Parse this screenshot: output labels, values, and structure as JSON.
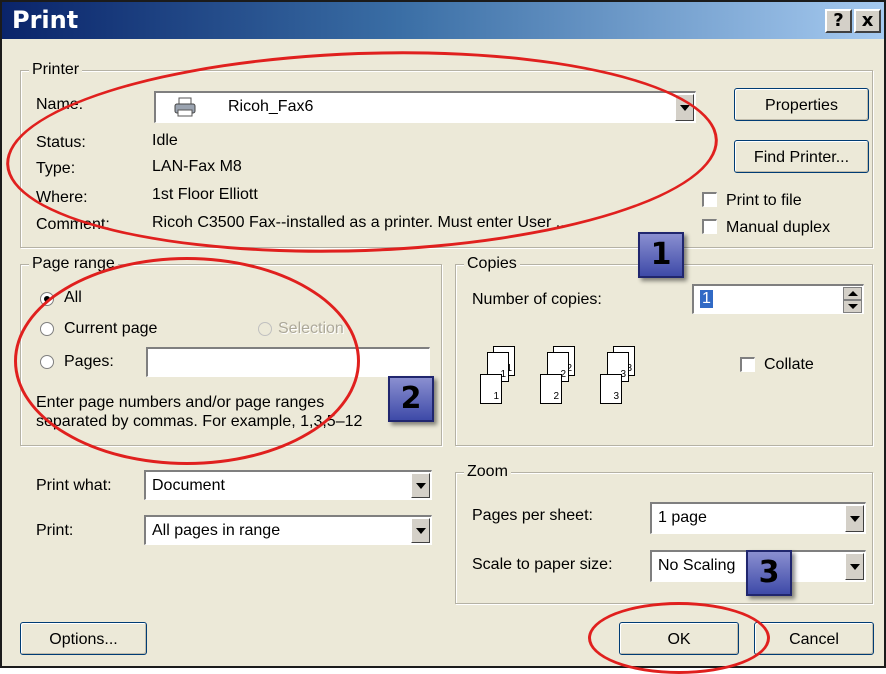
{
  "window": {
    "title": "Print",
    "help_btn": "?",
    "close_btn": "x"
  },
  "printer": {
    "group_label": "Printer",
    "name_label": "Name:",
    "name_value": "Ricoh_Fax6",
    "status_label": "Status:",
    "status_value": "Idle",
    "type_label": "Type:",
    "type_value": "LAN-Fax M8",
    "where_label": "Where:",
    "where_value": "1st Floor Elliott",
    "comment_label": "Comment:",
    "comment_value": "Ricoh C3500 Fax--installed as a printer. Must enter User ...",
    "properties_btn": "Properties",
    "find_printer_btn": "Find Printer...",
    "print_to_file": "Print to file",
    "manual_duplex": "Manual duplex"
  },
  "page_range": {
    "group_label": "Page range",
    "all": "All",
    "current_page": "Current page",
    "selection": "Selection",
    "pages": "Pages:",
    "pages_value": "",
    "hint_line1": "Enter page numbers and/or page ranges",
    "hint_line2": "separated by commas.  For example, 1,3,5–12"
  },
  "copies": {
    "group_label": "Copies",
    "number_label": "Number of copies:",
    "number_value": "1",
    "collate": "Collate",
    "stack_labels": [
      "1",
      "2",
      "3"
    ]
  },
  "print_what": {
    "label": "Print what:",
    "value": "Document"
  },
  "print": {
    "label": "Print:",
    "value": "All pages in range"
  },
  "zoom": {
    "group_label": "Zoom",
    "pages_per_sheet_label": "Pages per sheet:",
    "pages_per_sheet_value": "1 page",
    "scale_label": "Scale to paper size:",
    "scale_value": "No Scaling"
  },
  "buttons": {
    "options": "Options...",
    "ok": "OK",
    "cancel": "Cancel"
  },
  "callouts": [
    "1",
    "2",
    "3"
  ]
}
